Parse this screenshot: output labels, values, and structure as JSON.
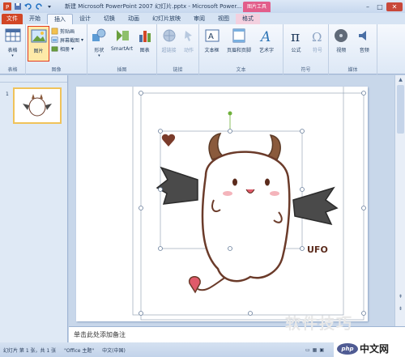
{
  "window": {
    "title": "新建 Microsoft PowerPoint 2007 幻灯片.pptx - Microsoft Power...",
    "context_tab_group": "图片工具"
  },
  "tabs": [
    {
      "label": "文件",
      "kind": "file"
    },
    {
      "label": "开始",
      "kind": "normal"
    },
    {
      "label": "插入",
      "kind": "active"
    },
    {
      "label": "设计",
      "kind": "normal"
    },
    {
      "label": "切换",
      "kind": "normal"
    },
    {
      "label": "动画",
      "kind": "normal"
    },
    {
      "label": "幻灯片放映",
      "kind": "normal"
    },
    {
      "label": "审阅",
      "kind": "normal"
    },
    {
      "label": "视图",
      "kind": "normal"
    },
    {
      "label": "格式",
      "kind": "ctx"
    }
  ],
  "ribbon": {
    "tables": {
      "group": "表格",
      "table": "表格"
    },
    "images": {
      "group": "图像",
      "picture": "图片",
      "clipart": "剪贴画",
      "screenshot": "屏幕截图",
      "album": "相册"
    },
    "illustrations": {
      "group": "插图",
      "shapes": "形状",
      "smartart": "SmartArt",
      "chart": "图表"
    },
    "links": {
      "group": "链接",
      "hyperlink": "超链接",
      "action": "动作"
    },
    "text": {
      "group": "文本",
      "textbox": "文本框",
      "headerfooter": "页眉和页脚",
      "wordart": "艺术字"
    },
    "symbols": {
      "group": "符号",
      "equation": "公式",
      "symbol": "符号"
    },
    "media": {
      "group": "媒体",
      "video": "视频",
      "audio": "音频"
    }
  },
  "slides": [
    {
      "number": "1"
    }
  ],
  "slide_content": {
    "image_text": "UFO"
  },
  "notes": {
    "placeholder": "单击此处添加备注"
  },
  "status": {
    "slide_info": "幻灯片 第 1 张，共 1 张",
    "theme": "\"Office 主题\"",
    "language": "中文(中国)"
  },
  "watermark": {
    "text": "软件技巧"
  },
  "logo": {
    "text": "中文网",
    "badge": "php"
  },
  "colors": {
    "accent": "#d24726",
    "context": "#e25e8b",
    "selection": "#e53b1d"
  }
}
